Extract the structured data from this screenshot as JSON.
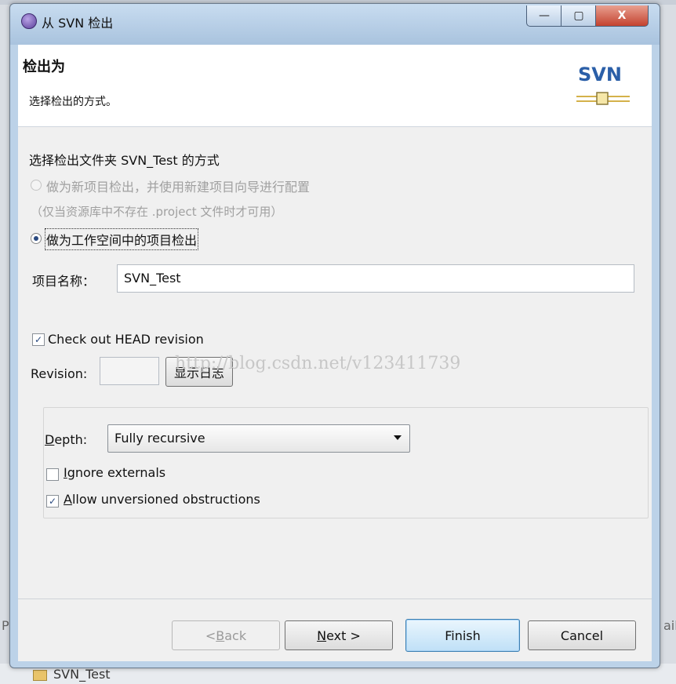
{
  "window": {
    "title": "从 SVN 检出",
    "controls": {
      "minimize": "—",
      "maximize": "▢",
      "close": "X"
    }
  },
  "banner": {
    "title": "检出为",
    "subtitle": "选择检出的方式。",
    "logo_text": "SVN"
  },
  "checkout": {
    "heading": "选择检出文件夹 SVN_Test 的方式",
    "options": [
      {
        "label": "做为新项目检出，并使用新建项目向导进行配置",
        "selected": false,
        "enabled": false
      },
      {
        "label": "做为工作空间中的项目检出",
        "selected": true,
        "enabled": true
      }
    ],
    "option_note": "（仅当资源库中不存在 .project 文件时才可用）",
    "project_name_label": "项目名称：",
    "project_name_value": "SVN_Test"
  },
  "revision": {
    "head_label": "Check out HEAD revision",
    "head_checked": true,
    "revision_label": "Revision:",
    "revision_value": "",
    "show_log_button": "显示日志"
  },
  "watermark": "http://blog.csdn.net/v123411739",
  "options_group": {
    "depth_label_prefix": "D",
    "depth_label_rest": "epth:",
    "depth_value": "Fully recursive",
    "ignore_externals_prefix": "I",
    "ignore_externals_rest": "gnore externals",
    "ignore_externals_checked": false,
    "allow_unversioned_prefix": "A",
    "allow_unversioned_rest": "llow unversioned obstructions",
    "allow_unversioned_checked": true
  },
  "buttons": {
    "back_prefix": "< ",
    "back_mnemonic": "B",
    "back_rest": "ack",
    "next_mnemonic": "N",
    "next_rest": "ext >",
    "finish": "Finish",
    "cancel": "Cancel"
  },
  "background": {
    "tree_item": "SVN_Test",
    "left_edge_letter": "P",
    "right_edge_letters": "ail"
  },
  "colors": {
    "title_bar": "#bcd2e8",
    "close_button": "#c4422f",
    "logo_blue": "#2b5fa8",
    "default_button": "#bfe0f7"
  }
}
